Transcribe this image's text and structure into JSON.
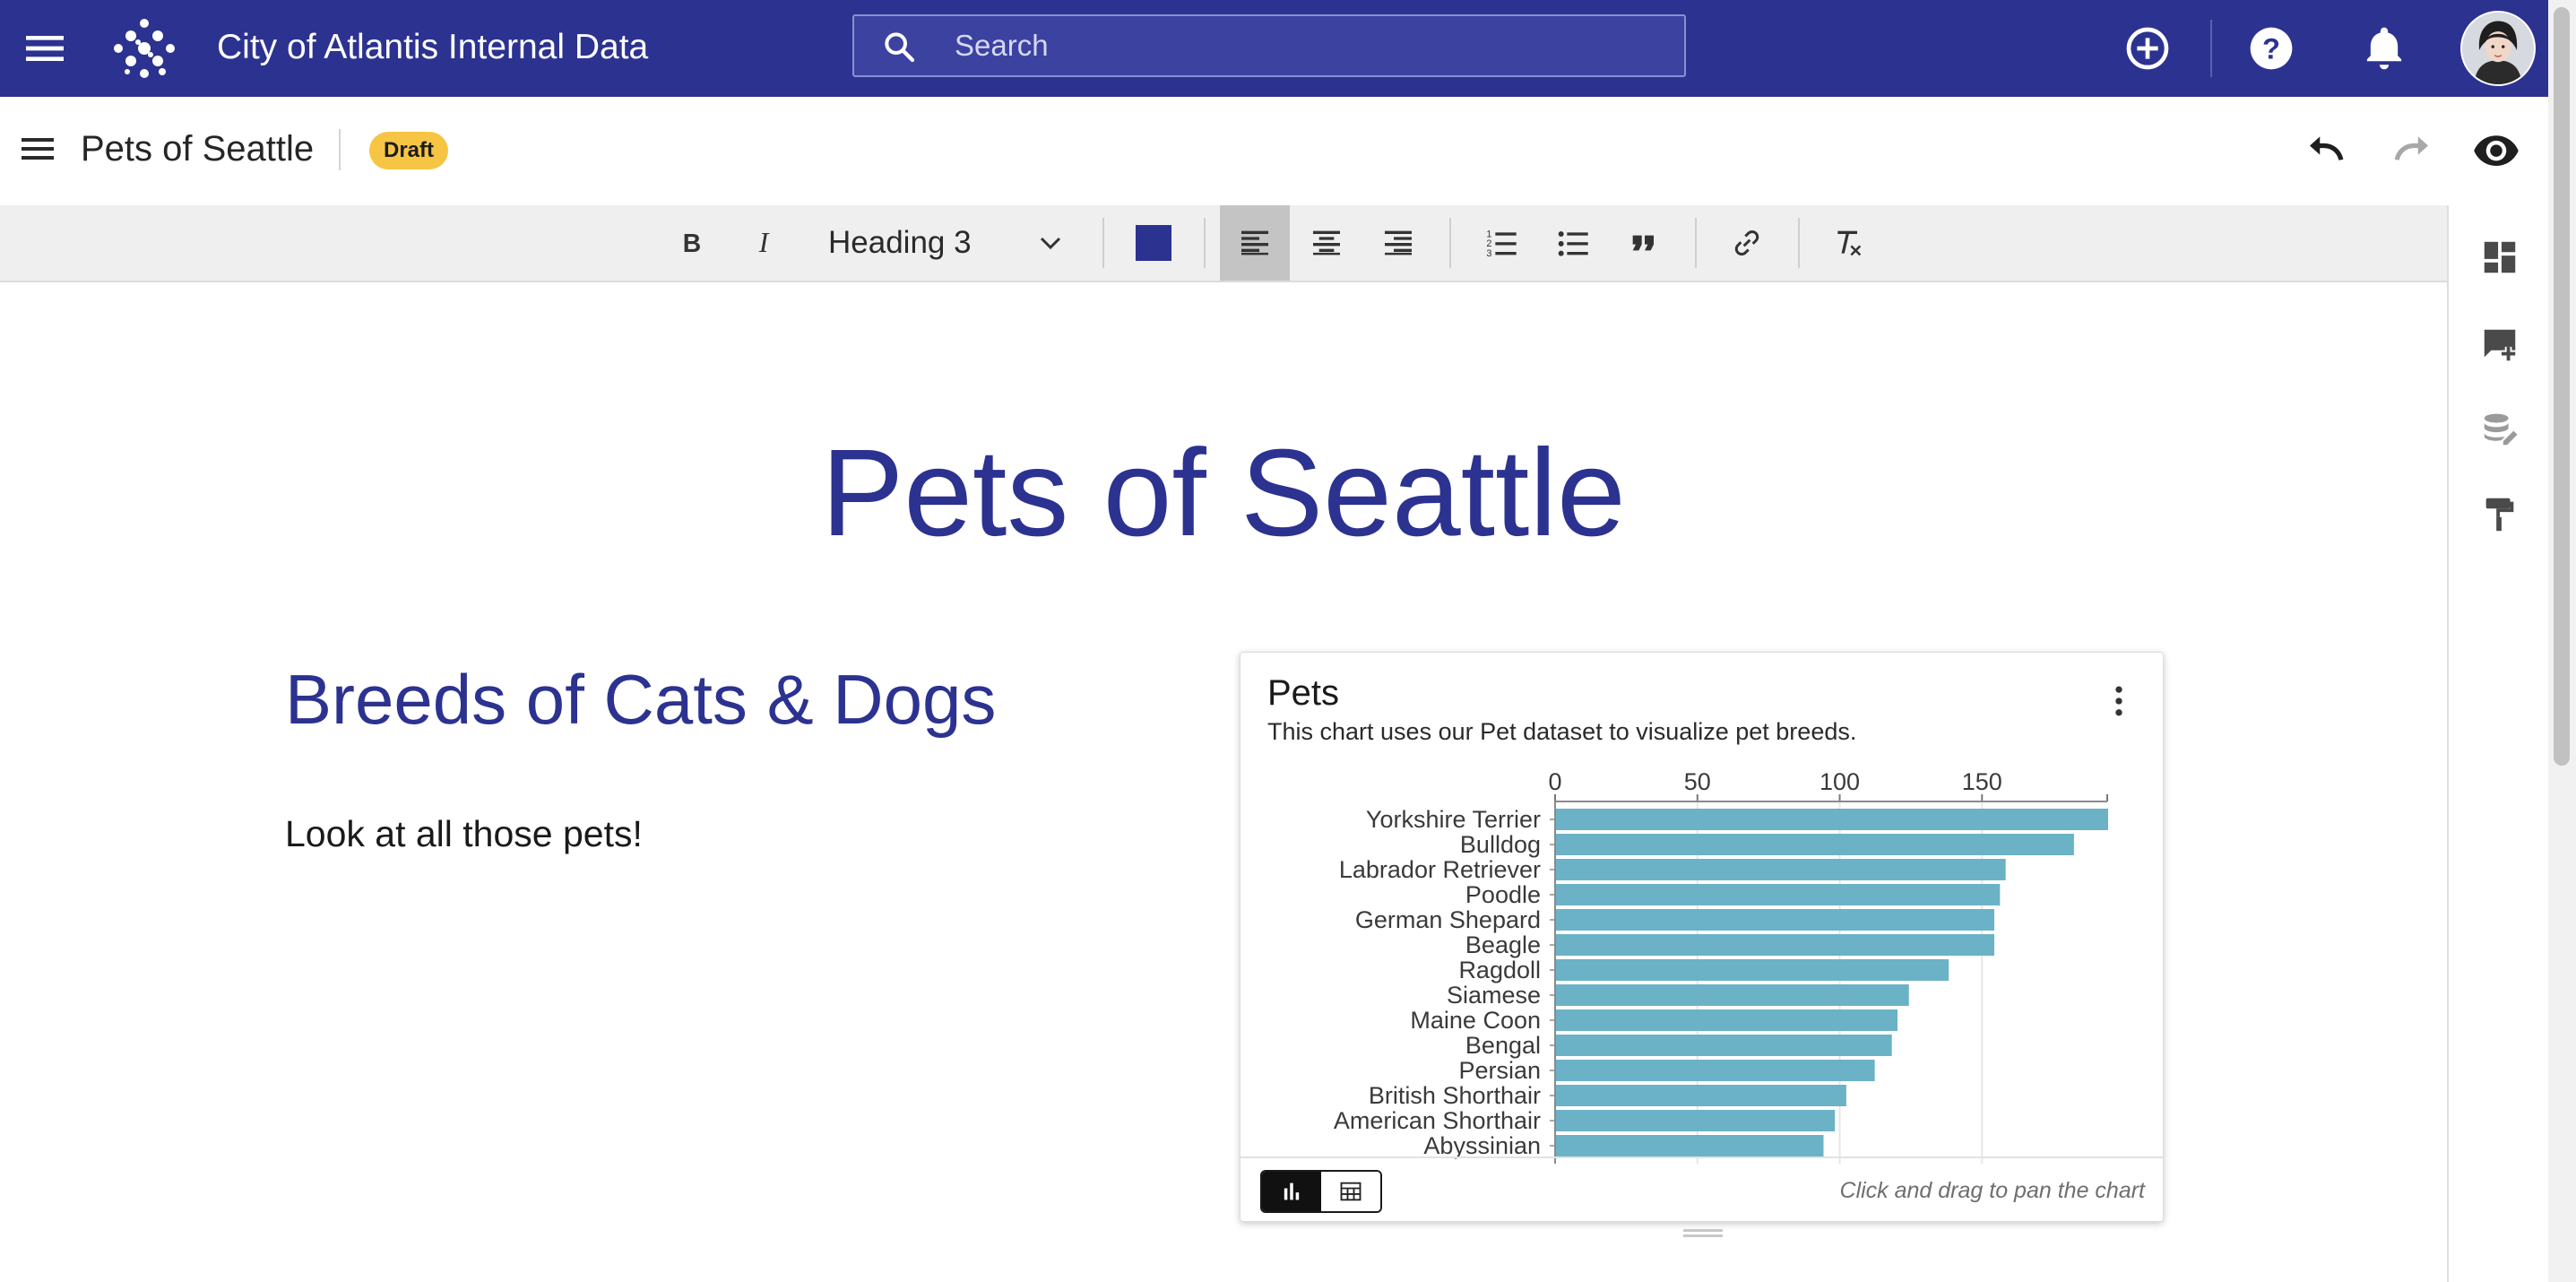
{
  "app": {
    "title": "City of Atlantis Internal Data",
    "search_placeholder": "Search",
    "colors": {
      "primary": "#2c3290",
      "badge": "#f7c544",
      "bar": "#6bb2c6"
    },
    "icons": [
      "menu-icon",
      "logo-icon",
      "search-icon",
      "add-circle-icon",
      "help-icon",
      "notifications-icon",
      "avatar"
    ]
  },
  "doc": {
    "name": "Pets of Seattle",
    "status": "Draft",
    "icons": [
      "undo-icon",
      "redo-icon",
      "preview-eye-icon"
    ]
  },
  "toolbar": {
    "heading_style": "Heading 3",
    "text_color": "#2c3290",
    "active_alignment": "left",
    "buttons": [
      "bold",
      "italic",
      "heading-select",
      "text-color",
      "align-left",
      "align-center",
      "align-right",
      "numbered-list",
      "bulleted-list",
      "blockquote",
      "link",
      "clear-formatting"
    ]
  },
  "siderail": {
    "icons": [
      "dashboard-icon",
      "add-comment-icon",
      "edit-data-icon",
      "format-paint-icon"
    ]
  },
  "content": {
    "title": "Pets of Seattle",
    "heading": "Breeds of Cats & Dogs",
    "body": "Look at all those pets!"
  },
  "chart_card": {
    "title": "Pets",
    "subtitle": "This chart uses our Pet dataset to visualize pet breeds.",
    "hint": "Click and drag to pan the chart",
    "view_toggle": {
      "selected": "chart",
      "options": [
        "chart",
        "table"
      ]
    }
  },
  "chart_data": {
    "type": "bar",
    "orientation": "horizontal",
    "categories": [
      "Yorkshire Terrier",
      "Bulldog",
      "Labrador Retriever",
      "Poodle",
      "German Shepard",
      "Beagle",
      "Ragdoll",
      "Siamese",
      "Maine Coon",
      "Bengal",
      "Persian",
      "British Shorthair",
      "American Shorthair",
      "Abyssinian"
    ],
    "values": [
      194,
      182,
      158,
      156,
      154,
      154,
      138,
      124,
      120,
      118,
      112,
      102,
      98,
      94
    ],
    "x_ticks": [
      0,
      50,
      100,
      150
    ],
    "xlim": [
      0,
      194
    ],
    "x_axis_position": "top",
    "grid": true,
    "bar_color": "#6bb2c6",
    "visible_rows": 14,
    "truncated": true
  }
}
